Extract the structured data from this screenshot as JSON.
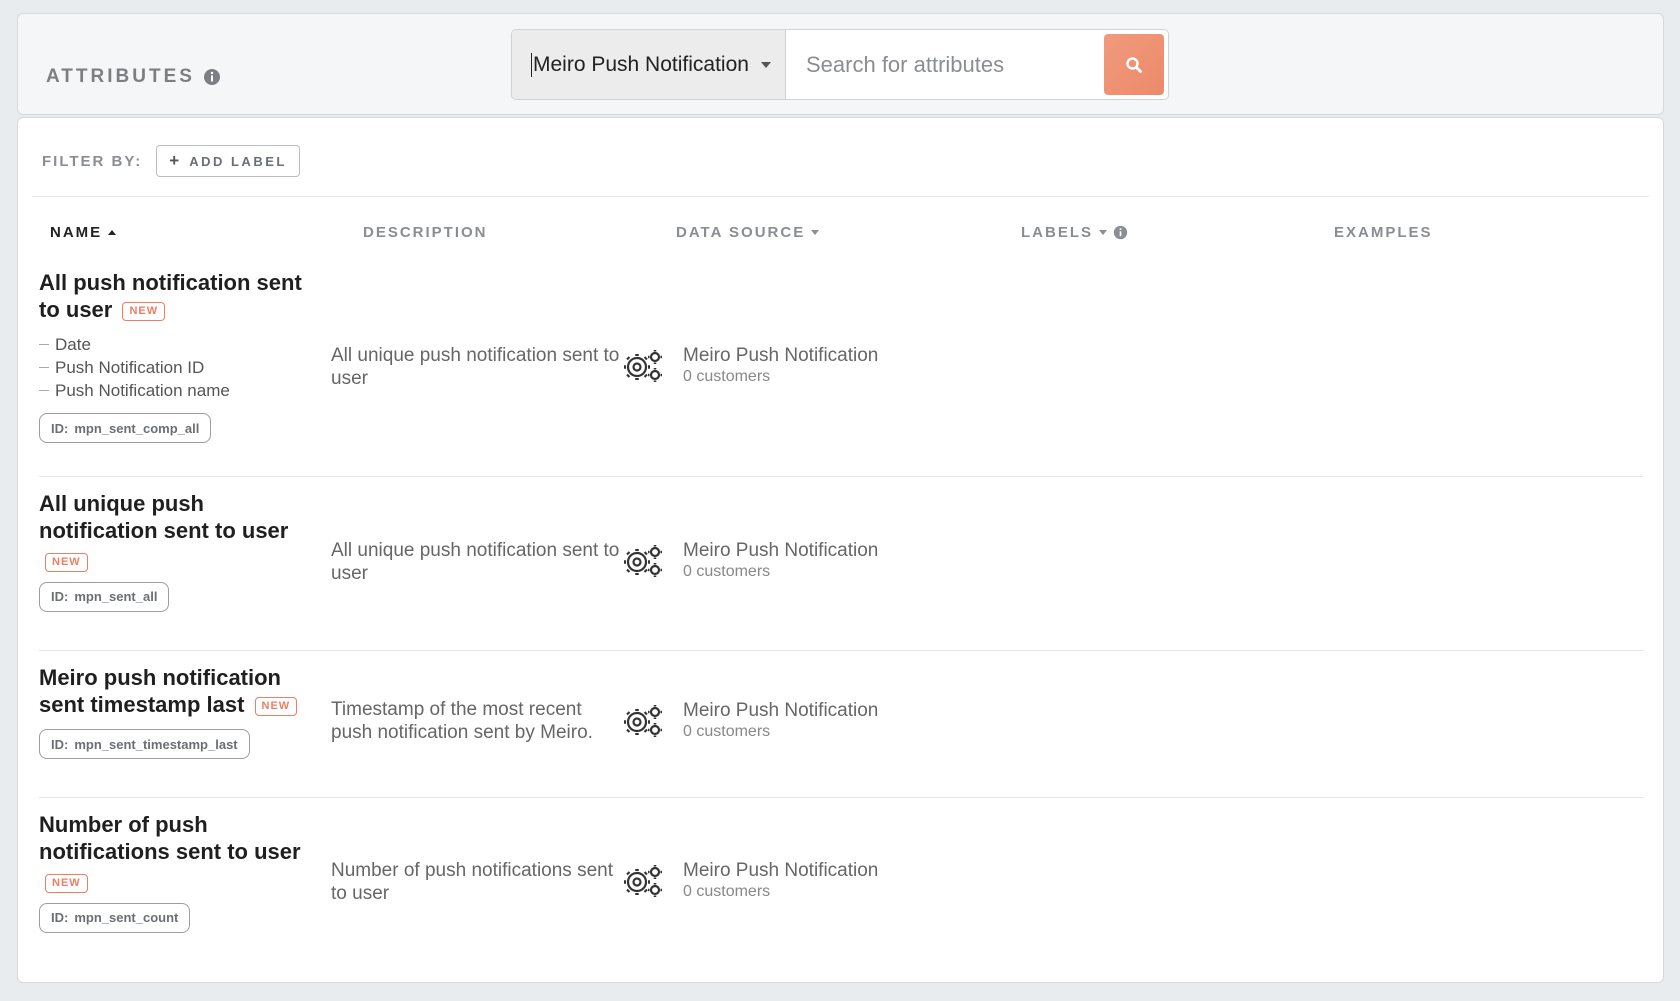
{
  "header": {
    "title": "ATTRIBUTES",
    "source_select": "Meiro Push Notification",
    "search_placeholder": "Search for attributes"
  },
  "filter": {
    "label": "FILTER BY:",
    "add_label_button": "ADD LABEL"
  },
  "columns": {
    "name": "NAME",
    "description": "DESCRIPTION",
    "data_source": "DATA SOURCE",
    "labels": "LABELS",
    "examples": "EXAMPLES"
  },
  "rows": [
    {
      "name_line1": "All push notification sent",
      "name_line2": "to user",
      "badge": "NEW",
      "sub_attributes": [
        "Date",
        "Push Notification ID",
        "Push Notification name"
      ],
      "id_prefix": "ID:",
      "id": "mpn_sent_comp_all",
      "description": "All unique push notification sent to user",
      "source_name": "Meiro Push Notification",
      "source_count": "0 customers"
    },
    {
      "name_line1": "All unique push",
      "name_line2": "notification sent to user",
      "badge": "NEW",
      "id_prefix": "ID:",
      "id": "mpn_sent_all",
      "description": "All unique push notification sent to user",
      "source_name": "Meiro Push Notification",
      "source_count": "0 customers"
    },
    {
      "name_line1": "Meiro push notification",
      "name_line2": "sent timestamp last",
      "badge": "NEW",
      "id_prefix": "ID:",
      "id": "mpn_sent_timestamp_last",
      "description": "Timestamp of the most recent push notification sent by Meiro.",
      "source_name": "Meiro Push Notification",
      "source_count": "0 customers"
    },
    {
      "name_line1": "Number of push",
      "name_line2": "notifications sent to user",
      "badge": "NEW",
      "id_prefix": "ID:",
      "id": "mpn_sent_count",
      "description": "Number of push notifications sent to user",
      "source_name": "Meiro Push Notification",
      "source_count": "0 customers"
    }
  ],
  "icons": {
    "info": "info-icon",
    "search": "search-icon",
    "data_source": "gears-icon",
    "plus": "plus-icon"
  },
  "colors": {
    "accent": "#ec8a6a",
    "badge": "#ec7e63"
  }
}
